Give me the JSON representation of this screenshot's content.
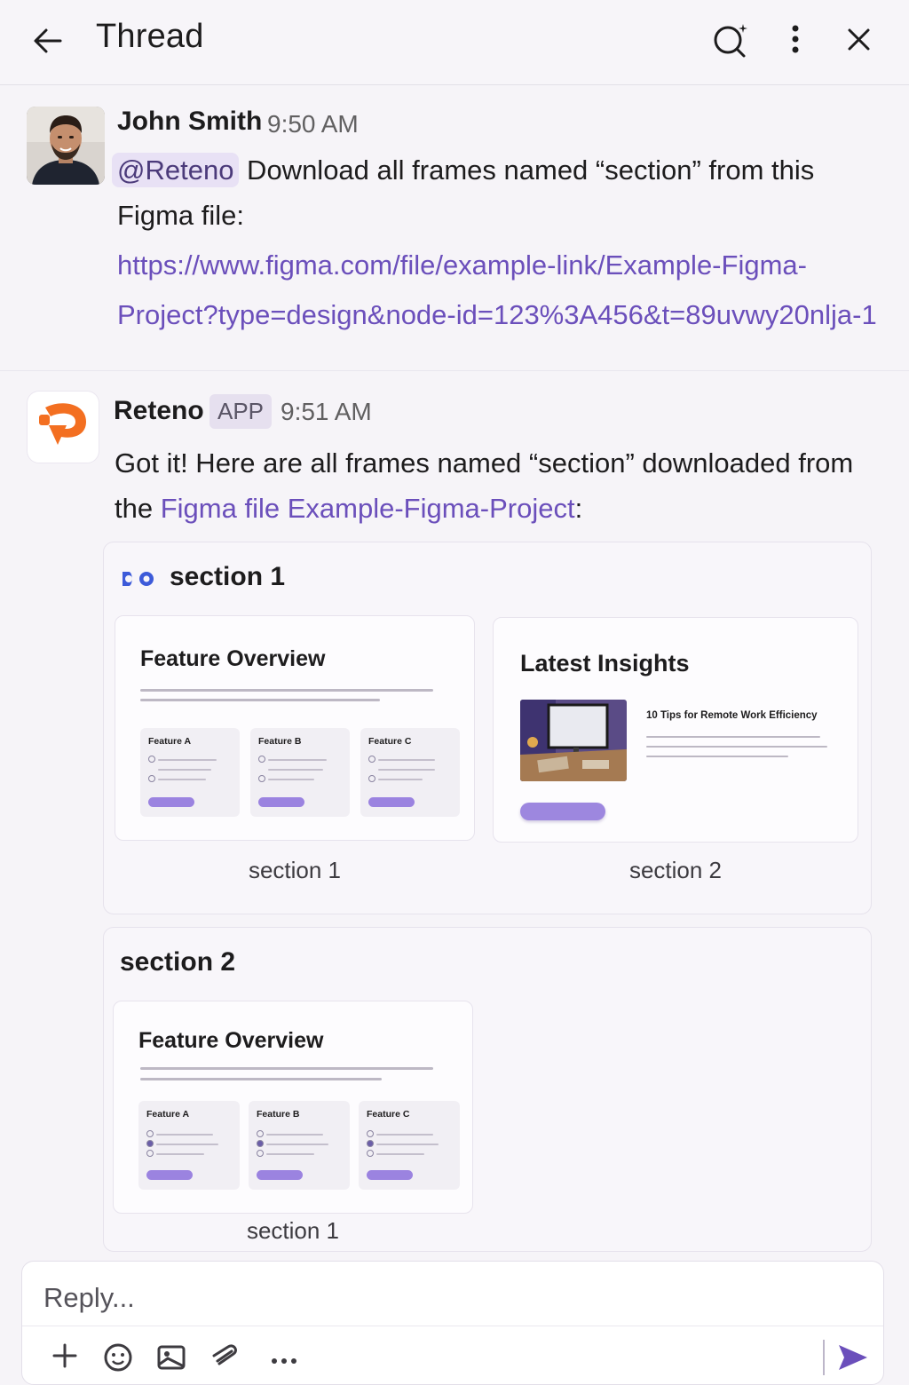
{
  "header": {
    "title": "Thread"
  },
  "message1": {
    "author": "John Smith",
    "time": "9:50 AM",
    "mention": "@Reteno",
    "text_line1": " Download all frames named “section” from this",
    "text_line2": "Figma file:",
    "link_line1": "https://www.figma.com/file/example-link/Example-Figma-",
    "link_line2": "Project?type=design&node-id=123%3A456&t=89uvwy20nlja-1"
  },
  "message2": {
    "author": "Reteno",
    "badge": "APP",
    "time": "9:51 AM",
    "text_line1": "Got it! Here are all frames named “section” downloaded from",
    "text_prefix": "the ",
    "link1": "Figma file",
    "link2": "Example-Figma-Project",
    "text_suffix": ":"
  },
  "card1": {
    "title": "section 1",
    "thumb1": {
      "heading": "Feature Overview",
      "features": [
        "Feature A",
        "Feature B",
        "Feature C"
      ],
      "caption": "section 1"
    },
    "thumb2": {
      "heading": "Latest Insights",
      "tip": "10 Tips for Remote Work Efficiency",
      "caption": "section 2"
    }
  },
  "card2": {
    "title": "section 2",
    "thumb1": {
      "heading": "Feature Overview",
      "features": [
        "Feature A",
        "Feature B",
        "Feature C"
      ],
      "caption": "section 1"
    }
  },
  "composer": {
    "placeholder": "Reply..."
  },
  "colors": {
    "accent": "#6b4fbb",
    "reteno_orange": "#f36f21",
    "figma_blue": "#3d5bd9",
    "button_purple": "#9b83e0"
  }
}
